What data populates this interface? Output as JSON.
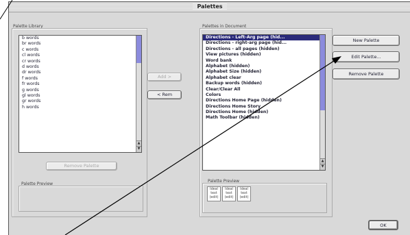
{
  "window": {
    "title": "Palettes"
  },
  "library": {
    "label": "Palette Library",
    "items": [
      "b words",
      "br words",
      "c words",
      "cl words",
      "cr words",
      "d words",
      "dr words",
      "f words",
      "fr words",
      "g words",
      "gl words",
      "gr words",
      "h words"
    ],
    "remove_button": "Remove Palette",
    "preview_label": "Palette Preview"
  },
  "middle": {
    "add_label": "Add >",
    "remove_label": "< Rem"
  },
  "document": {
    "label": "Palettes in Document",
    "items": [
      {
        "label": "Directions - Left-Arg page (hid...",
        "selected": true
      },
      {
        "label": "Directions - right-arg page (hid..."
      },
      {
        "label": "Directions - all pages (hidden)"
      },
      {
        "label": "View pictures (hidden)"
      },
      {
        "label": "Word bank"
      },
      {
        "label": "Alphabet (hidden)"
      },
      {
        "label": "Alphabet Size (hidden)"
      },
      {
        "label": "Alphabet clear"
      },
      {
        "label": "Backup words (hidden)"
      },
      {
        "label": "Clear/Clear All"
      },
      {
        "label": "Colors"
      },
      {
        "label": "Directions Home Page (hidden)"
      },
      {
        "label": "Directions Home Story"
      },
      {
        "label": "Directions Home (hidden)"
      },
      {
        "label": "Math Toolbar (hidden)"
      }
    ],
    "preview_label": "Palette Preview",
    "preview_cells": [
      "Ideal text (edit)",
      "Ideal text (edit)",
      "Ideal text (edit)"
    ]
  },
  "buttons": {
    "new_palette": "New Palette",
    "edit_palette": "Edit Palette...",
    "remove_palette": "Remove Palette",
    "ok": "OK"
  }
}
